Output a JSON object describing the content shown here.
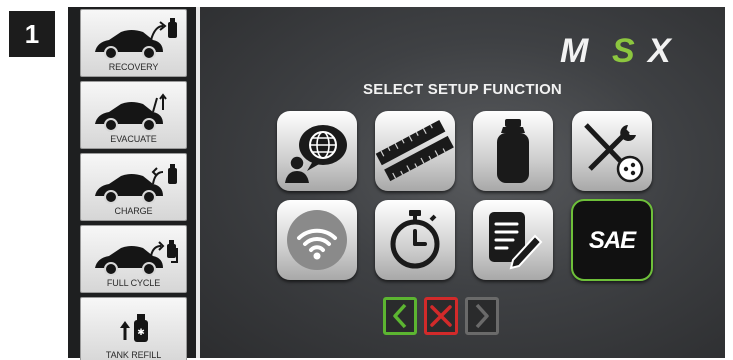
{
  "step_badge": "1",
  "brand": {
    "logo_text": "MSX",
    "colors": {
      "white": "#f2f2f2",
      "green": "#8cc63f"
    }
  },
  "sidebar": {
    "items": [
      {
        "label": "RECOVERY",
        "icon": "car-recovery-icon"
      },
      {
        "label": "EVACUATE",
        "icon": "car-evacuate-icon"
      },
      {
        "label": "CHARGE",
        "icon": "car-charge-icon"
      },
      {
        "label": "FULL CYCLE",
        "icon": "car-full-cycle-icon"
      },
      {
        "label": "TANK REFILL",
        "icon": "tank-refill-icon"
      }
    ]
  },
  "main": {
    "title": "SELECT SETUP FUNCTION",
    "tiles": [
      {
        "name": "language",
        "icon": "language-globe-icon"
      },
      {
        "name": "units",
        "icon": "measuring-tape-icon"
      },
      {
        "name": "tank",
        "icon": "refrigerant-tank-icon"
      },
      {
        "name": "service",
        "icon": "tools-service-icon"
      },
      {
        "name": "wifi",
        "icon": "wifi-icon"
      },
      {
        "name": "time",
        "icon": "stopwatch-icon"
      },
      {
        "name": "notes",
        "icon": "notepad-pen-icon"
      },
      {
        "name": "sae",
        "icon": "sae-logo-icon",
        "label": "SAE",
        "selected": true
      }
    ]
  },
  "nav": {
    "back": {
      "icon": "chevron-left-icon",
      "color": "#5cb531"
    },
    "cancel": {
      "icon": "close-x-icon",
      "color": "#d22a2a"
    },
    "forward": {
      "icon": "chevron-right-icon",
      "color": "#6a6a6a",
      "enabled": false
    }
  }
}
